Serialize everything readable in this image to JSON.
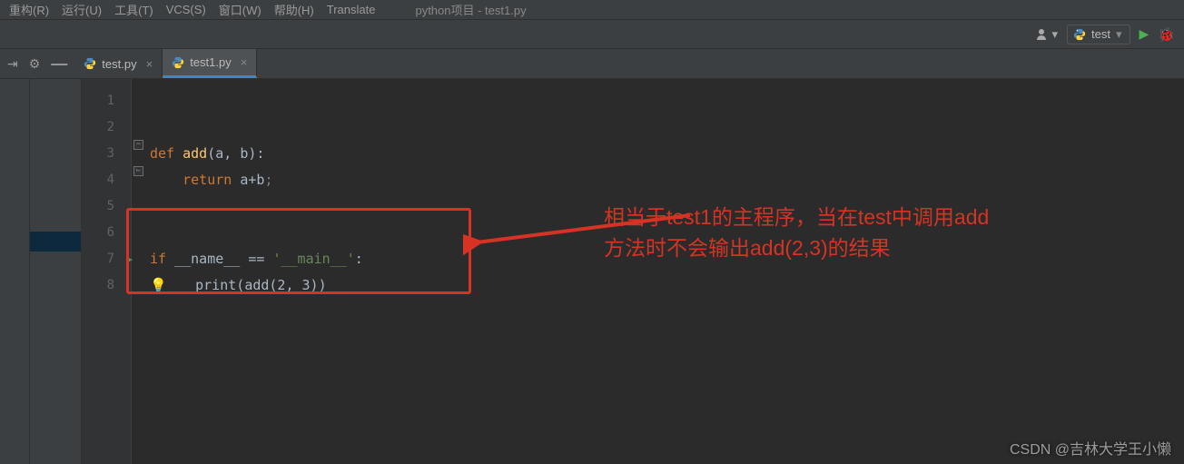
{
  "menu": {
    "items": [
      "重构(R)",
      "运行(U)",
      "工具(T)",
      "VCS(S)",
      "窗口(W)",
      "帮助(H)",
      "Translate"
    ],
    "breadcrumb": "python项目 - test1.py"
  },
  "toolbar": {
    "run_config_label": "test"
  },
  "tabs": [
    {
      "label": "test.py",
      "active": false
    },
    {
      "label": "test1.py",
      "active": true
    }
  ],
  "gutter": {
    "lines": [
      "1",
      "2",
      "3",
      "4",
      "5",
      "6",
      "7",
      "8"
    ],
    "run_marker_line": 7
  },
  "code": {
    "l3_def": "def ",
    "l3_fn": "add",
    "l3_params": "(a, b):",
    "l4_indent": "    ",
    "l4_return": "return ",
    "l4_expr": "a+b",
    "l7_if": "if ",
    "l7_name": "__name__ ",
    "l7_eq": "== ",
    "l7_str": "'__main__'",
    "l7_colon": ":",
    "l8_indent": "    ",
    "l8_print": "print",
    "l8_open": "(",
    "l8_call": "add",
    "l8_args": "(2, 3)",
    "l8_close": ")"
  },
  "annotation": {
    "line1": "相当于test1的主程序，当在test中调用add",
    "line2": "方法时不会输出add(2,3)的结果"
  },
  "watermark": "CSDN @吉林大学王小懒",
  "icons": {
    "gear": "gear-icon",
    "minus": "minus-icon",
    "user": "user-icon",
    "dropdown": "chevron-down-icon",
    "play": "play-icon",
    "bug": "bug-icon",
    "close": "close-icon",
    "bulb": "lightbulb-icon"
  }
}
